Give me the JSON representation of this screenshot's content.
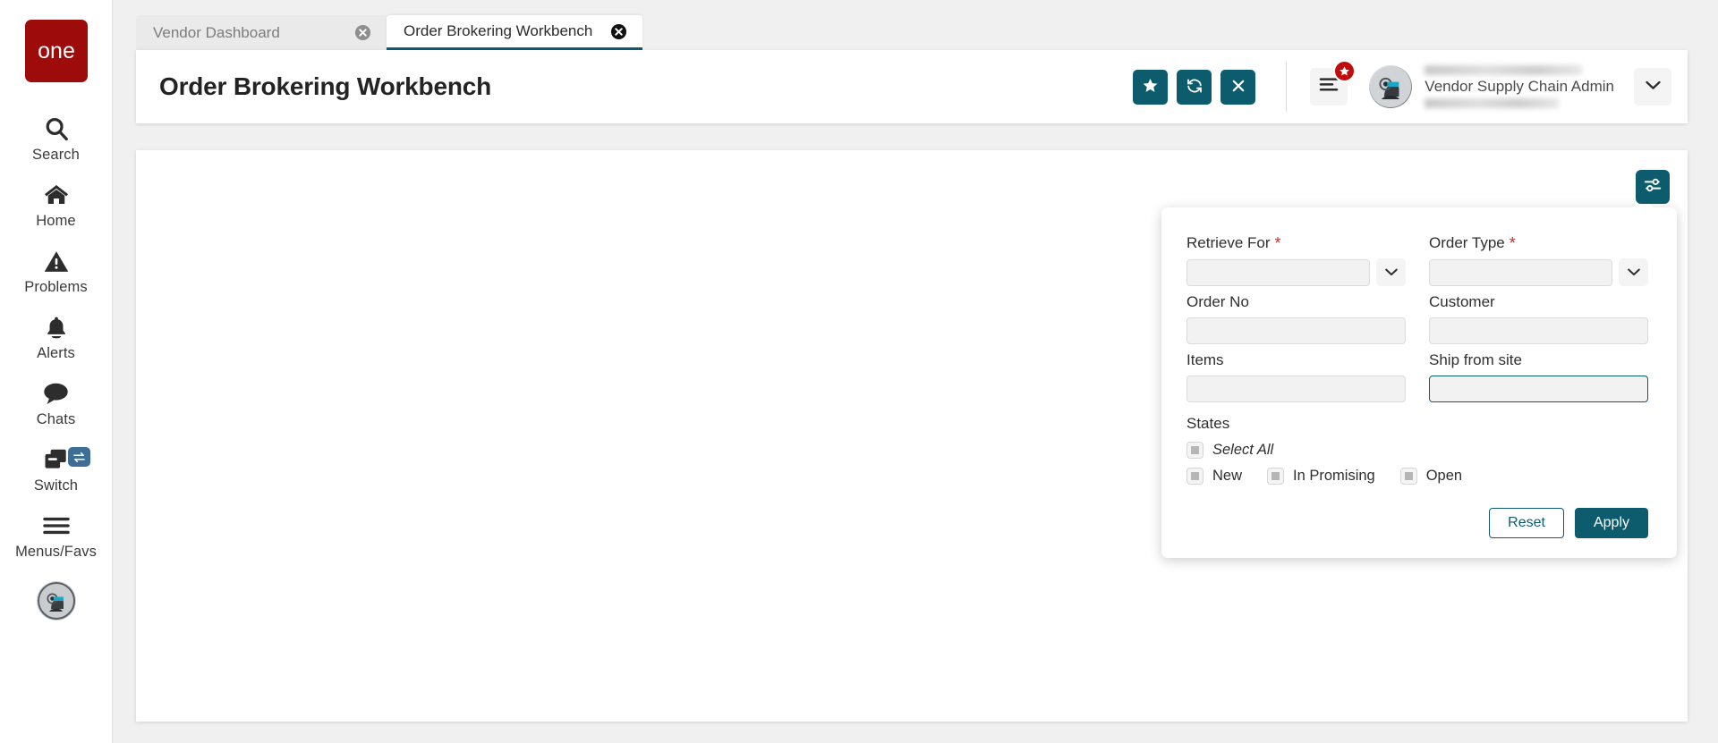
{
  "brand": {
    "logo_text": "one",
    "logo_color": "#9e0b0b",
    "accent_color": "#0d5c6e",
    "badge_color": "#c00c0c",
    "switch_badge_color": "#3d6e96"
  },
  "sidebar": {
    "items": [
      {
        "icon": "search-icon",
        "label": "Search"
      },
      {
        "icon": "home-icon",
        "label": "Home"
      },
      {
        "icon": "warning-triangle-icon",
        "label": "Problems"
      },
      {
        "icon": "bell-icon",
        "label": "Alerts"
      },
      {
        "icon": "chat-bubble-icon",
        "label": "Chats"
      },
      {
        "icon": "windows-icon",
        "label": "Switch"
      },
      {
        "icon": "hamburger-icon",
        "label": "Menus/Favs"
      }
    ],
    "avatar_name": "user-avatar"
  },
  "tabs": [
    {
      "label": "Vendor Dashboard",
      "active": false
    },
    {
      "label": "Order Brokering Workbench",
      "active": true
    }
  ],
  "header": {
    "title": "Order Brokering Workbench",
    "buttons": [
      {
        "icon": "star-icon",
        "name": "favorite-button"
      },
      {
        "icon": "refresh-icon",
        "name": "refresh-button"
      },
      {
        "icon": "close-icon",
        "name": "close-button"
      }
    ],
    "menu_icon": "menu-lines-icon",
    "menu_badge_icon": "star-icon",
    "user_role": "Vendor Supply Chain Admin",
    "user_caret_icon": "chevron-down-icon"
  },
  "content": {
    "filter_toggle_icon": "filter-sliders-icon"
  },
  "filter_panel": {
    "fields": [
      {
        "label": "Retrieve For",
        "required": true,
        "value": "",
        "placeholder": "",
        "has_caret": true,
        "focused": false,
        "name": "retrieve-for"
      },
      {
        "label": "Order Type",
        "required": true,
        "value": "",
        "placeholder": "",
        "has_caret": true,
        "focused": false,
        "name": "order-type"
      },
      {
        "label": "Order No",
        "required": false,
        "value": "",
        "placeholder": "",
        "has_caret": false,
        "focused": false,
        "name": "order-no"
      },
      {
        "label": "Customer",
        "required": false,
        "value": "",
        "placeholder": "",
        "has_caret": false,
        "focused": false,
        "name": "customer"
      },
      {
        "label": "Items",
        "required": false,
        "value": "",
        "placeholder": "",
        "has_caret": false,
        "focused": false,
        "name": "items"
      },
      {
        "label": "Ship from site",
        "required": false,
        "value": "",
        "placeholder": "",
        "has_caret": false,
        "focused": true,
        "name": "ship-from-site"
      }
    ],
    "states_label": "States",
    "select_all_label": "Select All",
    "state_options": [
      {
        "label": "New",
        "checked": false
      },
      {
        "label": "In Promising",
        "checked": false
      },
      {
        "label": "Open",
        "checked": false
      }
    ],
    "reset_label": "Reset",
    "apply_label": "Apply",
    "required_marker": "*"
  }
}
